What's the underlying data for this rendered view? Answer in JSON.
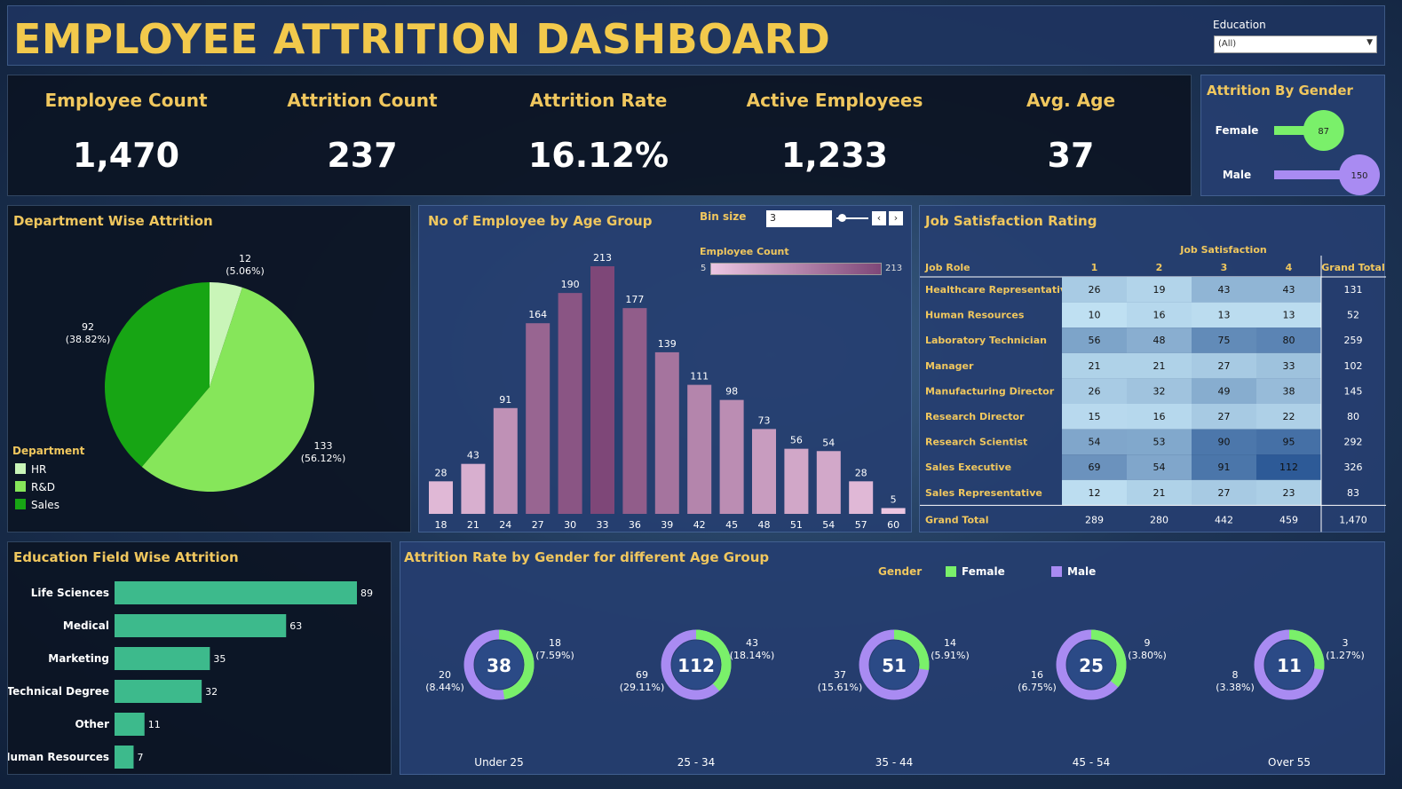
{
  "header": {
    "title": "EMPLOYEE ATTRITION DASHBOARD",
    "filter_label": "Education",
    "filter_value": "(All)"
  },
  "kpis": [
    {
      "label": "Employee Count",
      "value": "1,470"
    },
    {
      "label": "Attrition Count",
      "value": "237"
    },
    {
      "label": "Attrition Rate",
      "value": "16.12%"
    },
    {
      "label": "Active Employees",
      "value": "1,233"
    },
    {
      "label": "Avg. Age",
      "value": "37"
    }
  ],
  "colors": {
    "gold": "#f0c75e",
    "female": "#7af06a",
    "male": "#a98bf2",
    "edu_bar": "#3dba8c",
    "hr": "#c9f5b8",
    "rd": "#86e65a",
    "sales": "#17a514"
  },
  "chart_data": [
    {
      "type": "bar",
      "orientation": "horizontal",
      "title": "Attrition By Gender",
      "categories": [
        "Female",
        "Male"
      ],
      "values": [
        87,
        150
      ],
      "colors": [
        "#7af06a",
        "#a98bf2"
      ]
    },
    {
      "type": "pie",
      "title": "Department Wise Attrition",
      "legend_title": "Department",
      "legend_position": "bottom-left",
      "slices": [
        {
          "label": "HR",
          "value": 12,
          "percent": "5.06%",
          "color": "#c9f5b8"
        },
        {
          "label": "R&D",
          "value": 133,
          "percent": "56.12%",
          "color": "#86e65a"
        },
        {
          "label": "Sales",
          "value": 92,
          "percent": "38.82%",
          "color": "#17a514"
        }
      ]
    },
    {
      "type": "bar",
      "title": "No of Employee by Age Group",
      "bin_size_label": "Bin size",
      "bin_size": "3",
      "color_legend_title": "Employee Count",
      "color_range": [
        5,
        213
      ],
      "categories": [
        "18",
        "21",
        "24",
        "27",
        "30",
        "33",
        "36",
        "39",
        "42",
        "45",
        "48",
        "51",
        "54",
        "57",
        "60"
      ],
      "values": [
        28,
        43,
        91,
        164,
        190,
        213,
        177,
        139,
        111,
        98,
        73,
        56,
        54,
        28,
        5
      ],
      "ylim": [
        0,
        213
      ]
    },
    {
      "type": "heatmap",
      "title": "Job Satisfaction Rating",
      "column_group_label": "Job Satisfaction",
      "row_header": "Job Role",
      "columns": [
        "1",
        "2",
        "3",
        "4"
      ],
      "total_label": "Grand Total",
      "rows": [
        {
          "role": "Healthcare Representative",
          "values": [
            26,
            19,
            43,
            43
          ],
          "total": "131"
        },
        {
          "role": "Human Resources",
          "values": [
            10,
            16,
            13,
            13
          ],
          "total": "52"
        },
        {
          "role": "Laboratory Technician",
          "values": [
            56,
            48,
            75,
            80
          ],
          "total": "259"
        },
        {
          "role": "Manager",
          "values": [
            21,
            21,
            27,
            33
          ],
          "total": "102"
        },
        {
          "role": "Manufacturing Director",
          "values": [
            26,
            32,
            49,
            38
          ],
          "total": "145"
        },
        {
          "role": "Research Director",
          "values": [
            15,
            16,
            27,
            22
          ],
          "total": "80"
        },
        {
          "role": "Research Scientist",
          "values": [
            54,
            53,
            90,
            95
          ],
          "total": "292"
        },
        {
          "role": "Sales Executive",
          "values": [
            69,
            54,
            91,
            112
          ],
          "total": "326"
        },
        {
          "role": "Sales Representative",
          "values": [
            12,
            21,
            27,
            23
          ],
          "total": "83"
        }
      ],
      "grand_total_row": {
        "label": "Grand Total",
        "values": [
          "289",
          "280",
          "442",
          "459"
        ],
        "total": "1,470"
      }
    },
    {
      "type": "bar",
      "orientation": "horizontal",
      "title": "Education Field Wise Attrition",
      "categories": [
        "Life Sciences",
        "Medical",
        "Marketing",
        "Technical Degree",
        "Other",
        "Human Resources"
      ],
      "values": [
        89,
        63,
        35,
        32,
        11,
        7
      ]
    },
    {
      "type": "pie",
      "variant": "donut",
      "title": "Attrition Rate by Gender for different Age Group",
      "legend_title": "Gender",
      "legend": [
        "Female",
        "Male"
      ],
      "legend_position": "top-right",
      "groups": [
        {
          "label": "Under 25",
          "total": 38,
          "female": 18,
          "female_pct": "7.59%",
          "male": 20,
          "male_pct": "8.44%"
        },
        {
          "label": "25 - 34",
          "total": 112,
          "female": 43,
          "female_pct": "18.14%",
          "male": 69,
          "male_pct": "29.11%"
        },
        {
          "label": "35 - 44",
          "total": 51,
          "female": 14,
          "female_pct": "5.91%",
          "male": 37,
          "male_pct": "15.61%"
        },
        {
          "label": "45 - 54",
          "total": 25,
          "female": 9,
          "female_pct": "3.80%",
          "male": 16,
          "male_pct": "6.75%"
        },
        {
          "label": "Over 55",
          "total": 11,
          "female": 3,
          "female_pct": "1.27%",
          "male": 8,
          "male_pct": "3.38%"
        }
      ]
    }
  ]
}
